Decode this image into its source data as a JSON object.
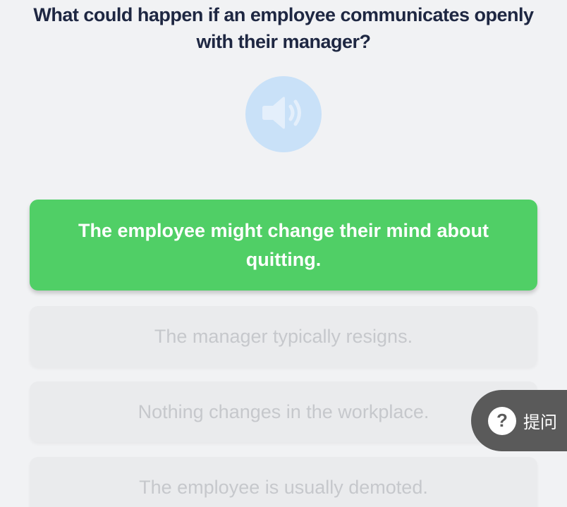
{
  "question": {
    "text": "What could happen if an employee communicates openly with their manager?"
  },
  "audio": {
    "icon": "speaker-icon",
    "color": "#c9e1f8"
  },
  "options": [
    {
      "label": "The employee might change their mind about quitting.",
      "state": "correct"
    },
    {
      "label": "The manager typically resigns.",
      "state": "disabled"
    },
    {
      "label": "Nothing changes in the workplace.",
      "state": "disabled"
    },
    {
      "label": "The employee is usually demoted.",
      "state": "disabled"
    }
  ],
  "help": {
    "glyph": "?",
    "label": "提问"
  },
  "colors": {
    "correct": "#50cf66",
    "question_text": "#1e2742",
    "background": "#f1f2f4"
  }
}
